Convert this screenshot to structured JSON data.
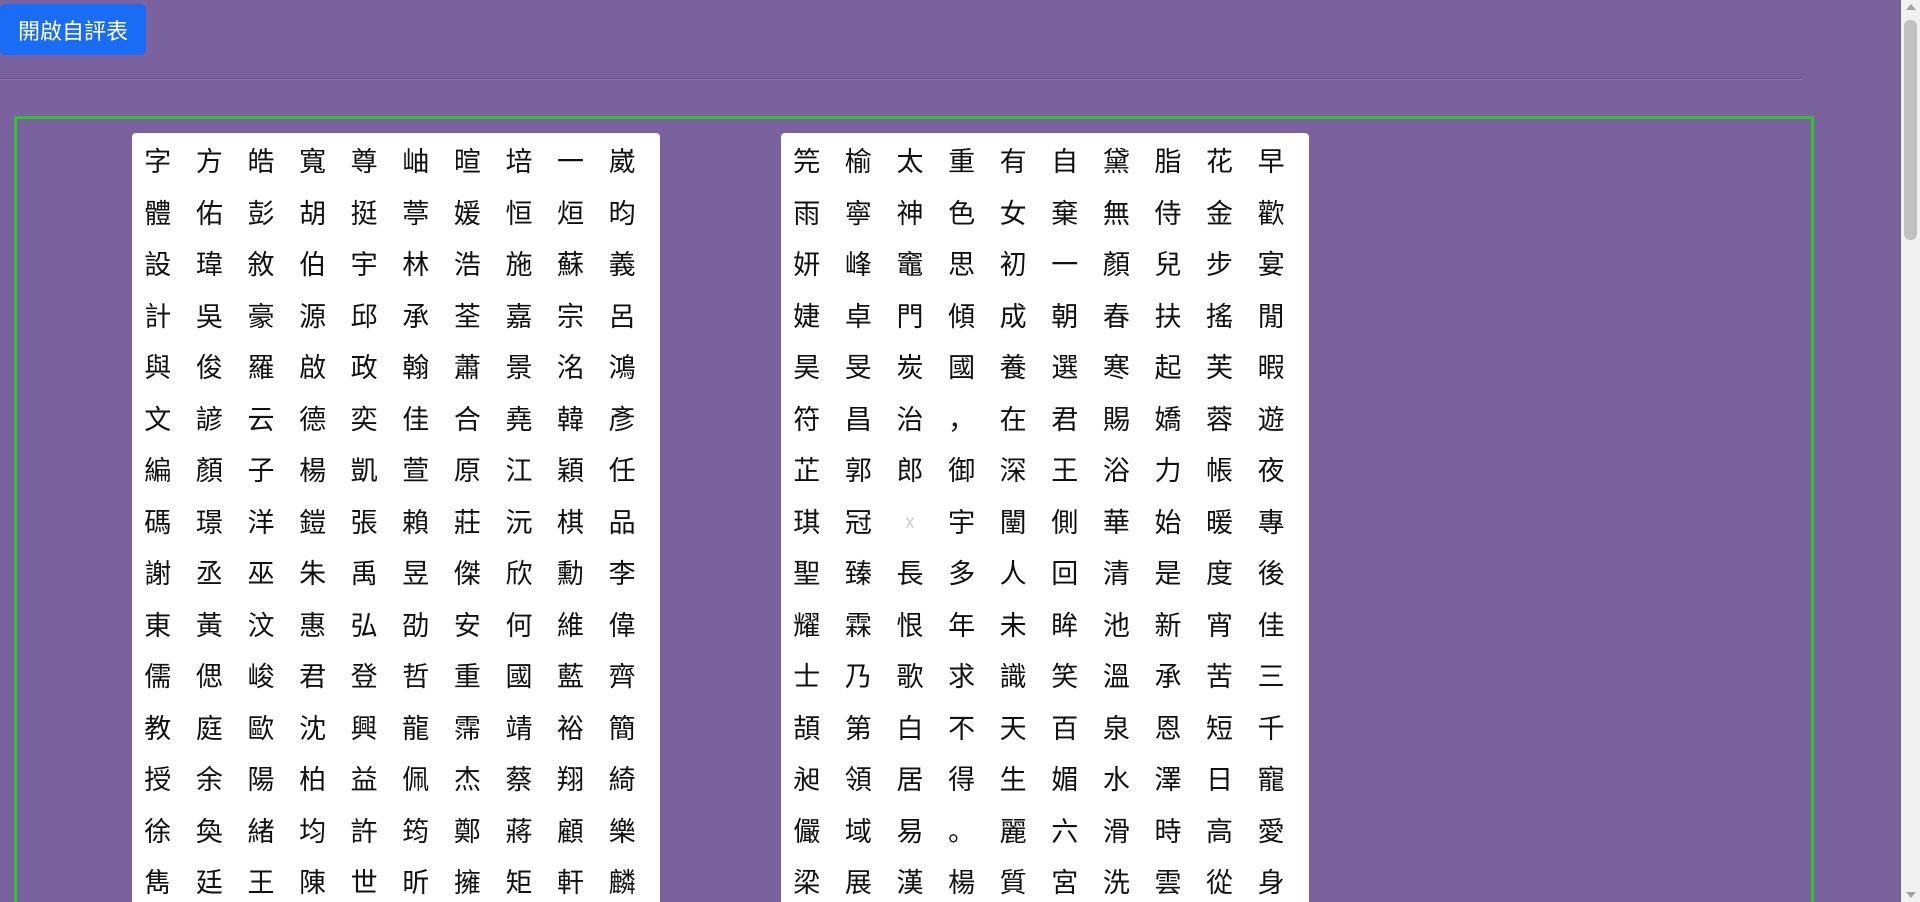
{
  "toolbar": {
    "open_button_label": "開啟自評表"
  },
  "colors": {
    "background": "#7a629e",
    "button": "#1a6cf7",
    "frame_border": "#2ec52e"
  },
  "left_grid": [
    [
      "字",
      "方",
      "皓",
      "寬",
      "尊",
      "岫",
      "暄",
      "培",
      "一",
      "崴"
    ],
    [
      "體",
      "佑",
      "彭",
      "胡",
      "挺",
      "葶",
      "媛",
      "恒",
      "烜",
      "昀"
    ],
    [
      "設",
      "瑋",
      "敘",
      "伯",
      "宇",
      "林",
      "浩",
      "施",
      "蘇",
      "義"
    ],
    [
      "計",
      "吳",
      "豪",
      "源",
      "邱",
      "承",
      "荃",
      "嘉",
      "宗",
      "呂"
    ],
    [
      "與",
      "俊",
      "羅",
      "啟",
      "政",
      "翰",
      "蕭",
      "景",
      "洺",
      "鴻"
    ],
    [
      "文",
      "諺",
      "云",
      "德",
      "奕",
      "佳",
      "合",
      "堯",
      "韓",
      "彥"
    ],
    [
      "編",
      "顏",
      "子",
      "楊",
      "凱",
      "萱",
      "原",
      "江",
      "穎",
      "任"
    ],
    [
      "碼",
      "璟",
      "洋",
      "鎧",
      "張",
      "賴",
      "莊",
      "沅",
      "棋",
      "品"
    ],
    [
      "謝",
      "丞",
      "巫",
      "朱",
      "禹",
      "昱",
      "傑",
      "欣",
      "勳",
      "李"
    ],
    [
      "東",
      "黃",
      "汶",
      "惠",
      "弘",
      "劭",
      "安",
      "何",
      "維",
      "偉"
    ],
    [
      "儒",
      "偲",
      "峻",
      "君",
      "登",
      "哲",
      "重",
      "國",
      "藍",
      "齊"
    ],
    [
      "教",
      "庭",
      "歐",
      "沈",
      "興",
      "龍",
      "霈",
      "靖",
      "裕",
      "簡"
    ],
    [
      "授",
      "余",
      "陽",
      "柏",
      "益",
      "佩",
      "杰",
      "蔡",
      "翔",
      "綺"
    ],
    [
      "徐",
      "奐",
      "緒",
      "均",
      "許",
      "筠",
      "鄭",
      "蔣",
      "顧",
      "樂"
    ],
    [
      "雋",
      "廷",
      "王",
      "陳",
      "世",
      "昕",
      "擁",
      "矩",
      "軒",
      "麟"
    ]
  ],
  "right_grid": [
    [
      "笎",
      "榆",
      "太",
      "重",
      "有",
      "自",
      "黛",
      "脂",
      "花",
      "早"
    ],
    [
      "雨",
      "寧",
      "神",
      "色",
      "女",
      "棄",
      "無",
      "侍",
      "金",
      "歡"
    ],
    [
      "妍",
      "峰",
      "竈",
      "思",
      "初",
      "一",
      "顏",
      "兒",
      "步",
      "宴"
    ],
    [
      "婕",
      "卓",
      "門",
      "傾",
      "成",
      "朝",
      "春",
      "扶",
      "搖",
      "閒"
    ],
    [
      "昊",
      "旻",
      "炭",
      "國",
      "養",
      "選",
      "寒",
      "起",
      "芙",
      "暇"
    ],
    [
      "符",
      "昌",
      "治",
      "，",
      "在",
      "君",
      "賜",
      "嬌",
      "蓉",
      "遊"
    ],
    [
      "芷",
      "郭",
      "郎",
      "御",
      "深",
      "王",
      "浴",
      "力",
      "帳",
      "夜"
    ],
    [
      "琪",
      "冠",
      "☓",
      "宇",
      "闉",
      "側",
      "華",
      "始",
      "暖",
      "專"
    ],
    [
      "聖",
      "臻",
      "長",
      "多",
      "人",
      "回",
      "清",
      "是",
      "度",
      "後"
    ],
    [
      "耀",
      "霖",
      "恨",
      "年",
      "未",
      "眸",
      "池",
      "新",
      "宵",
      "佳"
    ],
    [
      "士",
      "乃",
      "歌",
      "求",
      "識",
      "笑",
      "溫",
      "承",
      "苦",
      "三"
    ],
    [
      "頡",
      "第",
      "白",
      "不",
      "天",
      "百",
      "泉",
      "恩",
      "短",
      "千"
    ],
    [
      "昶",
      "領",
      "居",
      "得",
      "生",
      "媚",
      "水",
      "澤",
      "日",
      "寵"
    ],
    [
      "儼",
      "域",
      "易",
      "。",
      "麗",
      "六",
      "滑",
      "時",
      "高",
      "愛"
    ],
    [
      "梁",
      "展",
      "漢",
      "楊",
      "質",
      "宮",
      "洗",
      "雲",
      "從",
      "身"
    ]
  ]
}
